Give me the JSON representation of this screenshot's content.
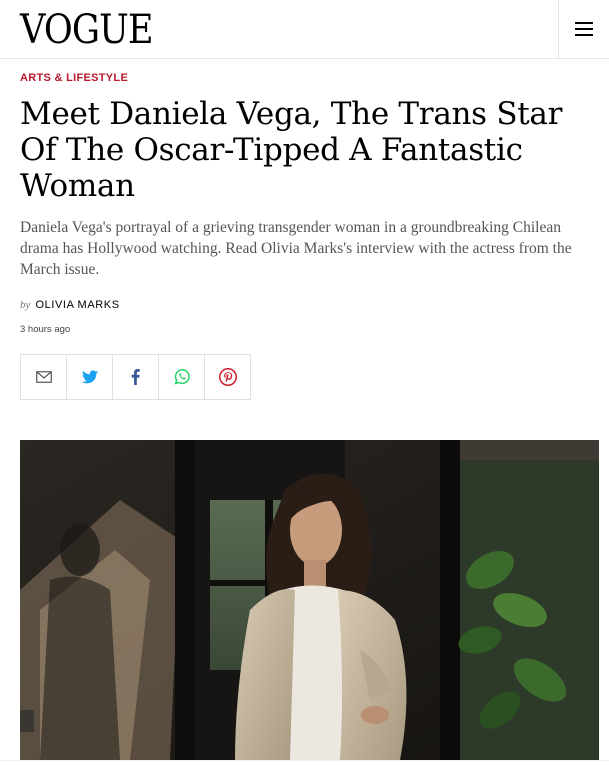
{
  "header": {
    "logo": "VOGUE",
    "menu_icon": "hamburger-menu-icon"
  },
  "article": {
    "category": "ARTS & LIFESTYLE",
    "headline": "Meet Daniela Vega, The Trans Star Of The Oscar-Tipped A Fantastic Woman",
    "dek": "Daniela Vega's portrayal of a grieving transgender woman in a groundbreaking Chilean drama has Hollywood watching. Read Olivia Marks's interview with the actress from the March issue.",
    "byline_prefix": "by",
    "author": "OLIVIA MARKS",
    "timestamp": "3 hours ago"
  },
  "share": {
    "icons": [
      "email-icon",
      "twitter-icon",
      "facebook-icon",
      "whatsapp-icon",
      "pinterest-icon"
    ],
    "colors": {
      "email": "#555555",
      "twitter": "#1da1f2",
      "facebook": "#3b5998",
      "whatsapp": "#25d366",
      "pinterest": "#cb2027"
    }
  },
  "theme": {
    "accent": "#b8182b"
  }
}
